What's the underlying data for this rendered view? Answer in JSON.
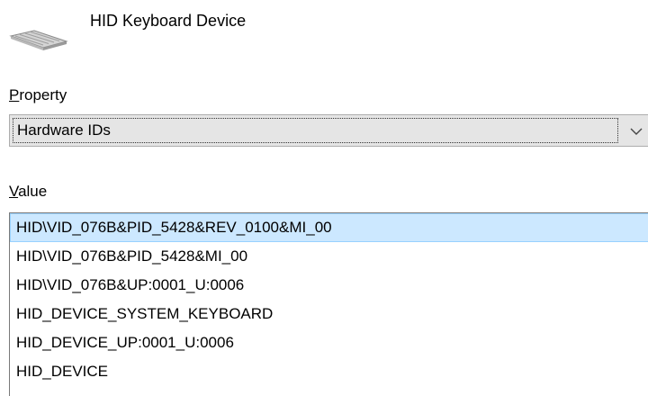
{
  "device": {
    "name": "HID Keyboard Device",
    "icon": "keyboard-icon"
  },
  "property": {
    "label_mnemonic": "P",
    "label_rest": "roperty",
    "selected": "Hardware IDs",
    "arrow_icon": "chevron-down-icon"
  },
  "value": {
    "label_mnemonic": "V",
    "label_rest": "alue",
    "items": [
      "HID\\VID_076B&PID_5428&REV_0100&MI_00",
      "HID\\VID_076B&PID_5428&MI_00",
      "HID\\VID_076B&UP:0001_U:0006",
      "HID_DEVICE_SYSTEM_KEYBOARD",
      "HID_DEVICE_UP:0001_U:0006",
      "HID_DEVICE"
    ],
    "selected_index": 0
  },
  "colors": {
    "selection_bg": "#cce8ff",
    "selection_border": "#99d1ff",
    "combo_bg": "#e5e5e5"
  }
}
